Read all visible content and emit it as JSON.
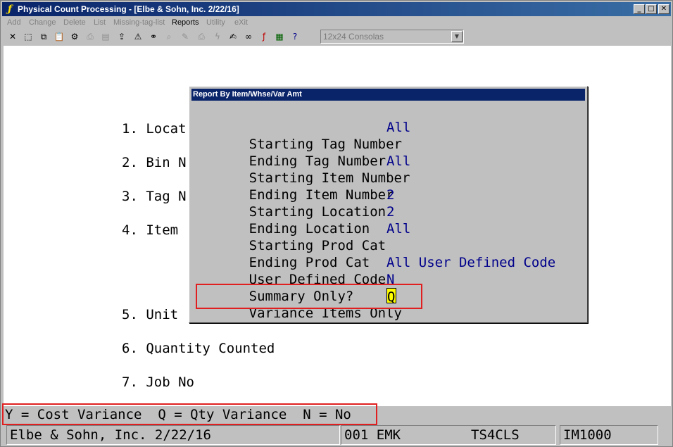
{
  "window": {
    "title": "Physical Count Processing - [Elbe & Sohn, Inc. 2/22/16]",
    "app_icon": "ƒ",
    "controls": {
      "minimize": "_",
      "maximize": "□",
      "close": "✕"
    }
  },
  "menubar": {
    "items": [
      {
        "label": "Add",
        "enabled": false
      },
      {
        "label": "Change",
        "enabled": false
      },
      {
        "label": "Delete",
        "enabled": false
      },
      {
        "label": "List",
        "enabled": false
      },
      {
        "label": "Missing-tag-list",
        "enabled": false
      },
      {
        "label": "Reports",
        "enabled": true
      },
      {
        "label": "Utility",
        "enabled": false
      },
      {
        "label": "eXit",
        "enabled": false
      }
    ]
  },
  "toolbar": {
    "icons": [
      {
        "name": "cancel-icon",
        "glyph": "✕"
      },
      {
        "name": "select-icon",
        "glyph": "⬚"
      },
      {
        "name": "copy-icon",
        "glyph": "⧉"
      },
      {
        "name": "paste-icon",
        "glyph": "📋"
      },
      {
        "name": "settings-icon",
        "glyph": "⚙"
      },
      {
        "name": "print-icon",
        "glyph": "⎙"
      },
      {
        "name": "document-icon",
        "glyph": "▤"
      },
      {
        "name": "export-icon",
        "glyph": "⇪"
      },
      {
        "name": "alert-icon",
        "glyph": "⚠"
      },
      {
        "name": "binoculars-icon",
        "glyph": "⚭"
      },
      {
        "name": "zoom-icon",
        "glyph": "⌕"
      },
      {
        "name": "pen-icon",
        "glyph": "✎"
      },
      {
        "name": "printer-icon",
        "glyph": "⎙"
      },
      {
        "name": "lightning-icon",
        "glyph": "ϟ"
      },
      {
        "name": "edit-icon",
        "glyph": "✍"
      },
      {
        "name": "link-icon",
        "glyph": "∞"
      },
      {
        "name": "function-icon",
        "glyph": "ƒ"
      },
      {
        "name": "list-icon",
        "glyph": "▦"
      },
      {
        "name": "help-icon",
        "glyph": "?"
      }
    ],
    "font_select": "12x24 Consolas"
  },
  "screen": {
    "menu_lines": [
      "1. Locat",
      "2. Bin N",
      "3. Tag N",
      "4. Item",
      "5. Unit",
      "6. Quantity Counted",
      "7. Job No"
    ]
  },
  "dialog": {
    "title": "Report By Item/Whse/Var Amt",
    "fields": [
      {
        "label": "Starting Tag Number",
        "value": "All"
      },
      {
        "label": "Ending Tag Number",
        "value": ""
      },
      {
        "label": "Starting Item Number",
        "value": "All"
      },
      {
        "label": "Ending Item Number",
        "value": ""
      },
      {
        "label": "Starting Location",
        "value": "2"
      },
      {
        "label": "Ending Location",
        "value": "2"
      },
      {
        "label": "Starting Prod Cat",
        "value": "All"
      },
      {
        "label": "Ending Prod Cat",
        "value": ""
      },
      {
        "label": "User Defined Code",
        "value": "All User Defined Code"
      },
      {
        "label": "Summary Only?",
        "value": "N"
      },
      {
        "label": "Variance Items Only",
        "value": "Q"
      }
    ]
  },
  "hint_line": "Y = Cost Variance  Q = Qty Variance  N = No",
  "status_bar": {
    "company": "Elbe & Sohn, Inc. 2/22/16",
    "user": "001 EMK",
    "terminal": "TS4CLS",
    "program": "IM1000"
  },
  "colors": {
    "title_bar": "#0a246a",
    "field_value": "#00008b",
    "highlight_box": "#e02020",
    "cursor": "#ffff00"
  }
}
